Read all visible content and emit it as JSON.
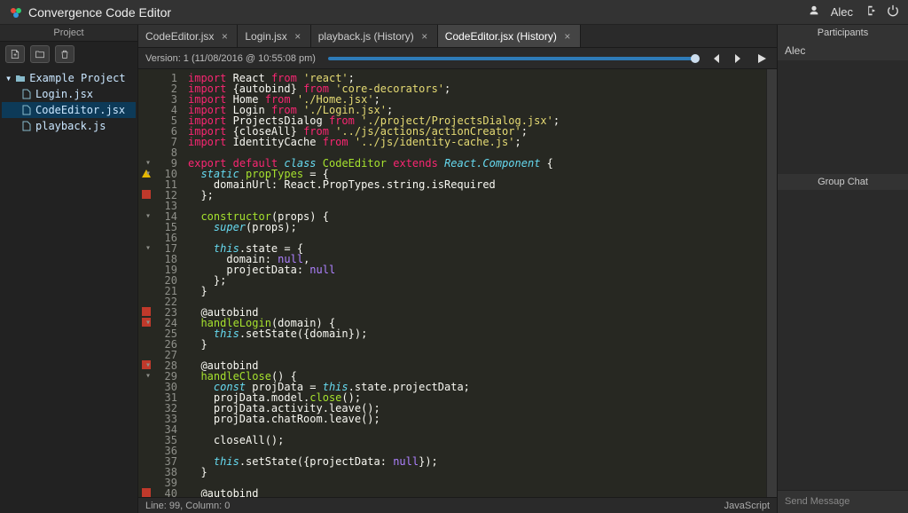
{
  "titlebar": {
    "title": "Convergence Code Editor",
    "user": "Alec"
  },
  "sidebar": {
    "header": "Project",
    "root": "Example Project",
    "files": [
      "Login.jsx",
      "CodeEditor.jsx",
      "playback.js"
    ],
    "selectedIndex": 1
  },
  "tabs": [
    {
      "label": "CodeEditor.jsx"
    },
    {
      "label": "Login.jsx"
    },
    {
      "label": "playback.js (History)"
    },
    {
      "label": "CodeEditor.jsx (History)"
    }
  ],
  "activeTab": 3,
  "history": {
    "label": "Version: 1 (11/08/2016 @ 10:55:08 pm)"
  },
  "status": {
    "left": "Line: 99, Column: 0",
    "right": "JavaScript"
  },
  "participants": {
    "header": "Participants",
    "items": [
      "Alec"
    ]
  },
  "chat": {
    "header": "Group Chat",
    "placeholder": "Send Message"
  },
  "gutter": {
    "marks": {
      "10": "warn",
      "12": "err",
      "23": "err",
      "24": "err",
      "28": "err",
      "40": "err"
    },
    "folds": [
      9,
      10,
      14,
      17,
      24,
      28,
      29
    ]
  },
  "code": [
    {
      "n": 1,
      "t": [
        [
          "kw",
          "import"
        ],
        [
          "id",
          " React "
        ],
        [
          "kw",
          "from"
        ],
        [
          "id",
          " "
        ],
        [
          "str",
          "'react'"
        ],
        [
          "id",
          ";"
        ]
      ]
    },
    {
      "n": 2,
      "t": [
        [
          "kw",
          "import"
        ],
        [
          "id",
          " {autobind} "
        ],
        [
          "kw",
          "from"
        ],
        [
          "id",
          " "
        ],
        [
          "str",
          "'core-decorators'"
        ],
        [
          "id",
          ";"
        ]
      ]
    },
    {
      "n": 3,
      "t": [
        [
          "kw",
          "import"
        ],
        [
          "id",
          " Home "
        ],
        [
          "kw",
          "from"
        ],
        [
          "id",
          " "
        ],
        [
          "str",
          "'./Home.jsx'"
        ],
        [
          "id",
          ";"
        ]
      ]
    },
    {
      "n": 4,
      "t": [
        [
          "kw",
          "import"
        ],
        [
          "id",
          " Login "
        ],
        [
          "kw",
          "from"
        ],
        [
          "id",
          " "
        ],
        [
          "str",
          "'./Login.jsx'"
        ],
        [
          "id",
          ";"
        ]
      ]
    },
    {
      "n": 5,
      "t": [
        [
          "kw",
          "import"
        ],
        [
          "id",
          " ProjectsDialog "
        ],
        [
          "kw",
          "from"
        ],
        [
          "id",
          " "
        ],
        [
          "str",
          "'./project/ProjectsDialog.jsx'"
        ],
        [
          "id",
          ";"
        ]
      ]
    },
    {
      "n": 6,
      "t": [
        [
          "kw",
          "import"
        ],
        [
          "id",
          " {closeAll} "
        ],
        [
          "kw",
          "from"
        ],
        [
          "id",
          " "
        ],
        [
          "str",
          "'../js/actions/actionCreator'"
        ],
        [
          "id",
          ";"
        ]
      ]
    },
    {
      "n": 7,
      "t": [
        [
          "kw",
          "import"
        ],
        [
          "id",
          " IdentityCache "
        ],
        [
          "kw",
          "from"
        ],
        [
          "id",
          " "
        ],
        [
          "str",
          "'../js/identity-cache.js'"
        ],
        [
          "id",
          ";"
        ]
      ]
    },
    {
      "n": 8,
      "t": [
        [
          "id",
          ""
        ]
      ]
    },
    {
      "n": 9,
      "t": [
        [
          "kw",
          "export"
        ],
        [
          "id",
          " "
        ],
        [
          "kw",
          "default"
        ],
        [
          "id",
          " "
        ],
        [
          "kw2",
          "class"
        ],
        [
          "id",
          " "
        ],
        [
          "name",
          "CodeEditor"
        ],
        [
          "id",
          " "
        ],
        [
          "kw",
          "extends"
        ],
        [
          "id",
          " "
        ],
        [
          "kw2",
          "React.Component"
        ],
        [
          "id",
          " {"
        ]
      ]
    },
    {
      "n": 10,
      "t": [
        [
          "id",
          "  "
        ],
        [
          "kw2",
          "static"
        ],
        [
          "id",
          " "
        ],
        [
          "name",
          "propTypes"
        ],
        [
          "id",
          " = {"
        ]
      ]
    },
    {
      "n": 11,
      "t": [
        [
          "id",
          "    domainUrl: React.PropTypes.string.isRequired"
        ]
      ]
    },
    {
      "n": 12,
      "t": [
        [
          "id",
          "  };"
        ]
      ]
    },
    {
      "n": 13,
      "t": [
        [
          "id",
          ""
        ]
      ]
    },
    {
      "n": 14,
      "t": [
        [
          "id",
          "  "
        ],
        [
          "name",
          "constructor"
        ],
        [
          "id",
          "(props) {"
        ]
      ]
    },
    {
      "n": 15,
      "t": [
        [
          "id",
          "    "
        ],
        [
          "kw2",
          "super"
        ],
        [
          "id",
          "(props);"
        ]
      ]
    },
    {
      "n": 16,
      "t": [
        [
          "id",
          ""
        ]
      ]
    },
    {
      "n": 17,
      "t": [
        [
          "id",
          "    "
        ],
        [
          "kw2",
          "this"
        ],
        [
          "id",
          ".state = {"
        ]
      ]
    },
    {
      "n": 18,
      "t": [
        [
          "id",
          "      domain: "
        ],
        [
          "num",
          "null"
        ],
        [
          "id",
          ","
        ]
      ]
    },
    {
      "n": 19,
      "t": [
        [
          "id",
          "      projectData: "
        ],
        [
          "num",
          "null"
        ]
      ]
    },
    {
      "n": 20,
      "t": [
        [
          "id",
          "    };"
        ]
      ]
    },
    {
      "n": 21,
      "t": [
        [
          "id",
          "  }"
        ]
      ]
    },
    {
      "n": 22,
      "t": [
        [
          "id",
          ""
        ]
      ]
    },
    {
      "n": 23,
      "t": [
        [
          "id",
          "  @autobind"
        ]
      ]
    },
    {
      "n": 24,
      "t": [
        [
          "id",
          "  "
        ],
        [
          "name",
          "handleLogin"
        ],
        [
          "id",
          "(domain) {"
        ]
      ]
    },
    {
      "n": 25,
      "t": [
        [
          "id",
          "    "
        ],
        [
          "kw2",
          "this"
        ],
        [
          "id",
          ".setState({domain});"
        ]
      ]
    },
    {
      "n": 26,
      "t": [
        [
          "id",
          "  }"
        ]
      ]
    },
    {
      "n": 27,
      "t": [
        [
          "id",
          ""
        ]
      ]
    },
    {
      "n": 28,
      "t": [
        [
          "id",
          "  @autobind"
        ]
      ]
    },
    {
      "n": 29,
      "t": [
        [
          "id",
          "  "
        ],
        [
          "name",
          "handleClose"
        ],
        [
          "id",
          "() {"
        ]
      ]
    },
    {
      "n": 30,
      "t": [
        [
          "id",
          "    "
        ],
        [
          "kw2",
          "const"
        ],
        [
          "id",
          " projData = "
        ],
        [
          "kw2",
          "this"
        ],
        [
          "id",
          ".state.projectData;"
        ]
      ]
    },
    {
      "n": 31,
      "t": [
        [
          "id",
          "    projData.model."
        ],
        [
          "name",
          "close"
        ],
        [
          "id",
          "();"
        ]
      ]
    },
    {
      "n": 32,
      "t": [
        [
          "id",
          "    projData.activity.leave();"
        ]
      ]
    },
    {
      "n": 33,
      "t": [
        [
          "id",
          "    projData.chatRoom.leave();"
        ]
      ]
    },
    {
      "n": 34,
      "t": [
        [
          "id",
          ""
        ]
      ]
    },
    {
      "n": 35,
      "t": [
        [
          "id",
          "    closeAll();"
        ]
      ]
    },
    {
      "n": 36,
      "t": [
        [
          "id",
          ""
        ]
      ]
    },
    {
      "n": 37,
      "t": [
        [
          "id",
          "    "
        ],
        [
          "kw2",
          "this"
        ],
        [
          "id",
          ".setState({projectData: "
        ],
        [
          "num",
          "null"
        ],
        [
          "id",
          "});"
        ]
      ]
    },
    {
      "n": 38,
      "t": [
        [
          "id",
          "  }"
        ]
      ]
    },
    {
      "n": 39,
      "t": [
        [
          "id",
          ""
        ]
      ]
    },
    {
      "n": 40,
      "t": [
        [
          "id",
          "  @autobind"
        ]
      ]
    }
  ]
}
